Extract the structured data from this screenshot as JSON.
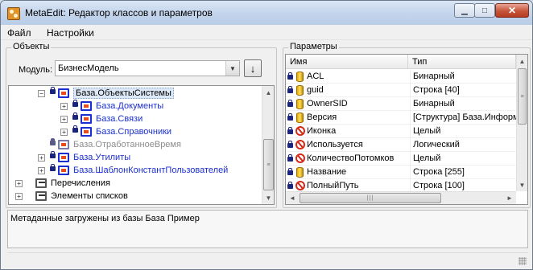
{
  "window": {
    "title": "MetaEdit: Редактор классов и параметров",
    "min_glyph": "▁",
    "max_glyph": "□",
    "close_glyph": "✕"
  },
  "menu": {
    "items": [
      "Файл",
      "Настройки"
    ]
  },
  "objects_panel": {
    "title": "Объекты",
    "module_label": "Модуль:",
    "module_value": "БизнесМодель",
    "combo_arrow": "▼",
    "go_glyph": "↓",
    "tree": [
      {
        "label": "База.ОбъектыСистемы",
        "expander": "−",
        "style": "selected",
        "icon": "lock-object"
      },
      {
        "label": "База.Документы",
        "expander": "+",
        "style": "link",
        "icon": "lock-object"
      },
      {
        "label": "База.Связи",
        "expander": "+",
        "style": "link",
        "icon": "lock-object"
      },
      {
        "label": "База.Справочники",
        "expander": "+",
        "style": "link",
        "icon": "lock-object"
      },
      {
        "label": "База.ОтработанноеВремя",
        "expander": "",
        "style": "muted",
        "icon": "lock-object-gray"
      },
      {
        "label": "База.Утилиты",
        "expander": "+",
        "style": "link",
        "icon": "lock-object"
      },
      {
        "label": "База.ШаблонКонстантПользователей",
        "expander": "+",
        "style": "link",
        "icon": "lock-object"
      },
      {
        "label": "Перечисления",
        "expander": "+",
        "style": "plain",
        "icon": "enum-folder"
      },
      {
        "label": "Элементы списков",
        "expander": "+",
        "style": "plain",
        "icon": "list-folder"
      }
    ]
  },
  "params_panel": {
    "title": "Параметры",
    "columns": [
      "Имя",
      "Тип"
    ],
    "rows": [
      {
        "name": "ACL",
        "type": "Бинарный",
        "icon": "database"
      },
      {
        "name": "guid",
        "type": "Строка [40]",
        "icon": "database"
      },
      {
        "name": "OwnerSID",
        "type": "Бинарный",
        "icon": "database"
      },
      {
        "name": "Версия",
        "type": "[Структура] База.Информ",
        "icon": "database"
      },
      {
        "name": "Иконка",
        "type": "Целый",
        "icon": "forbidden"
      },
      {
        "name": "Используется",
        "type": "Логический",
        "icon": "forbidden"
      },
      {
        "name": "КоличествоПотомков",
        "type": "Целый",
        "icon": "forbidden"
      },
      {
        "name": "Название",
        "type": "Строка [255]",
        "icon": "database"
      },
      {
        "name": "ПолныйПуть",
        "type": "Строка [100]",
        "icon": "forbidden"
      }
    ]
  },
  "scroll": {
    "up": "▲",
    "down": "▼",
    "left": "◄",
    "right": "►",
    "grip": "≡",
    "hgrip": "|||"
  },
  "status": {
    "message": "Метаданные загружены из базы База Пример"
  }
}
